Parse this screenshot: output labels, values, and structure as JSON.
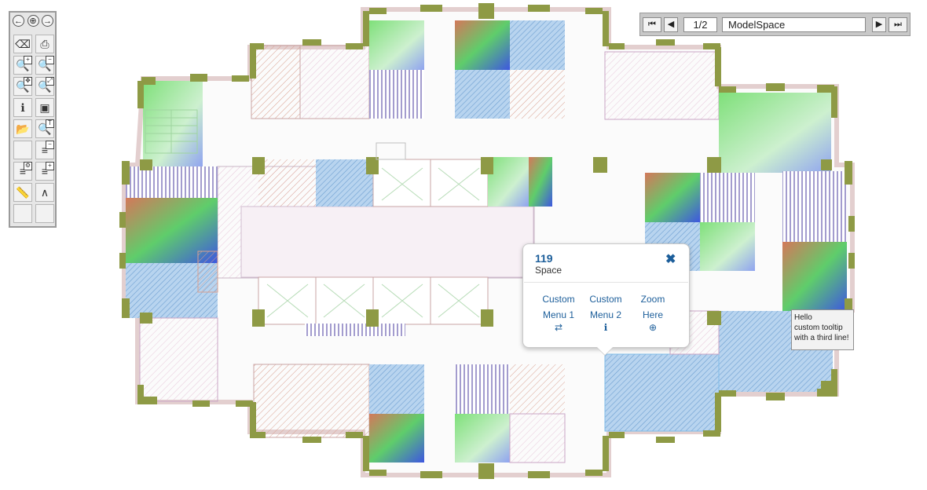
{
  "toolbar": {
    "nav": [
      {
        "name": "pan-left-icon",
        "glyph": "←"
      },
      {
        "name": "pan-all-icon",
        "glyph": "⊕"
      },
      {
        "name": "pan-right-icon",
        "glyph": "→"
      }
    ],
    "tools": [
      {
        "name": "eraser-icon",
        "glyph": "⌫",
        "badge": ""
      },
      {
        "name": "printer-icon",
        "glyph": "⎙",
        "badge": ""
      },
      {
        "name": "zoom-in-icon",
        "glyph": "🔍",
        "badge": "+"
      },
      {
        "name": "zoom-out-icon",
        "glyph": "🔍",
        "badge": "−"
      },
      {
        "name": "zoom-window-icon",
        "glyph": "🔍",
        "badge": "✥"
      },
      {
        "name": "zoom-extents-icon",
        "glyph": "🔍",
        "badge": "⤢"
      },
      {
        "name": "info-icon",
        "glyph": "ℹ",
        "badge": ""
      },
      {
        "name": "layers-color-icon",
        "glyph": "▣",
        "badge": ""
      },
      {
        "name": "open-folder-icon",
        "glyph": "📂",
        "badge": ""
      },
      {
        "name": "search-text-icon",
        "glyph": "🔍",
        "badge": "T"
      },
      {
        "name": "blank-tool-icon",
        "glyph": "",
        "badge": ""
      },
      {
        "name": "layer-remove-icon",
        "glyph": "≡",
        "badge": "−"
      },
      {
        "name": "layer-settings-icon",
        "glyph": "≡",
        "badge": "⚙"
      },
      {
        "name": "layer-add-icon",
        "glyph": "≡",
        "badge": "+"
      },
      {
        "name": "measure-ruler-icon",
        "glyph": "📏",
        "badge": ""
      },
      {
        "name": "compass-icon",
        "glyph": "∧",
        "badge": ""
      },
      {
        "name": "blank-tool-2-icon",
        "glyph": "",
        "badge": ""
      },
      {
        "name": "blank-tool-3-icon",
        "glyph": "",
        "badge": ""
      }
    ]
  },
  "pager": {
    "first_glyph": "⏮",
    "prev_glyph": "◀",
    "page_value": "1/2",
    "layout_value": "ModelSpace",
    "next_glyph": "▶",
    "last_glyph": "⏭"
  },
  "popup": {
    "title": "119",
    "subtitle": "Space",
    "close_glyph": "✖",
    "menus": [
      {
        "line1": "Custom",
        "line2": "Menu 1",
        "icon": "⇄",
        "icon_name": "swap-arrows-icon"
      },
      {
        "line1": "Custom",
        "line2": "Menu 2",
        "icon": "ℹ",
        "icon_name": "info-circle-icon"
      },
      {
        "line1": "Zoom",
        "line2": "Here",
        "icon": "⊕",
        "icon_name": "zoom-in-icon"
      }
    ]
  },
  "tooltip": {
    "lines": [
      "Hello",
      "custom tooltip",
      "with a third line!"
    ]
  },
  "colors": {
    "wall": "#8e9a45",
    "accent": "#1c5e9a"
  }
}
